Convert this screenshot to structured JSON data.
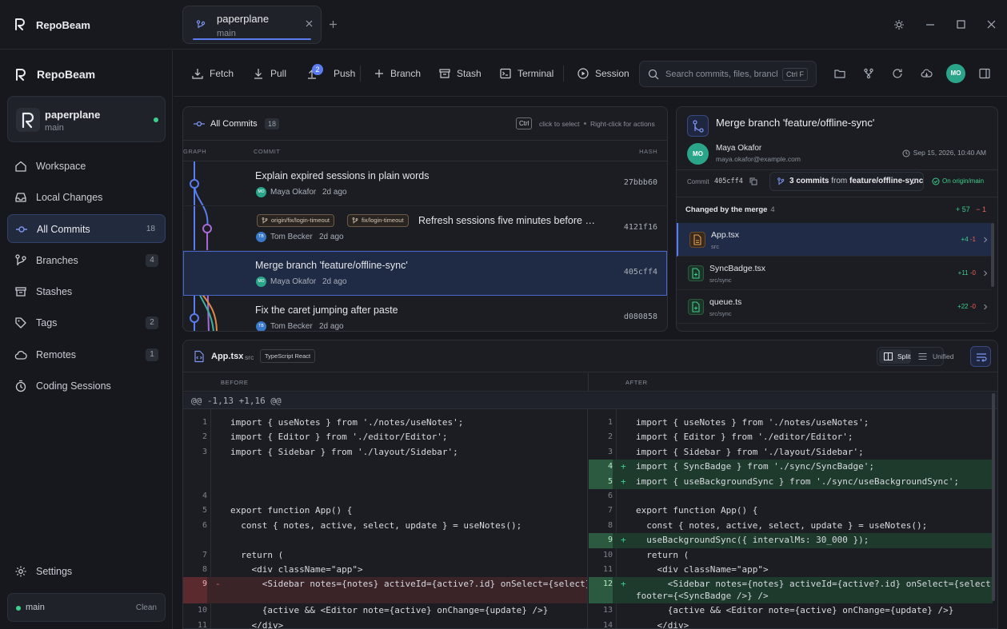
{
  "app": {
    "name": "RepoBeam"
  },
  "tab": {
    "name": "paperplane",
    "branch": "main"
  },
  "sidebar": {
    "repo": {
      "name": "paperplane",
      "branch": "main"
    },
    "items": [
      {
        "label": "Workspace",
        "icon": "home-icon"
      },
      {
        "label": "Local Changes",
        "icon": "inbox-icon"
      },
      {
        "label": "All Commits",
        "icon": "commit-icon",
        "count": "18"
      },
      {
        "label": "Branches",
        "icon": "branch-icon",
        "count": "4"
      },
      {
        "label": "Stashes",
        "icon": "archive-icon"
      },
      {
        "label": "Tags",
        "icon": "tag-icon",
        "count": "2"
      },
      {
        "label": "Remotes",
        "icon": "cloud-icon",
        "count": "1"
      },
      {
        "label": "Coding Sessions",
        "icon": "timer-icon"
      }
    ],
    "settings": "Settings",
    "status": {
      "branch": "main",
      "state": "Clean"
    }
  },
  "toolbar": {
    "fetch": "Fetch",
    "pull": "Pull",
    "push": "Push",
    "push_count": "2",
    "branch": "Branch",
    "stash": "Stash",
    "terminal": "Terminal",
    "session": "Session",
    "search_placeholder": "Search commits, files, branches",
    "search_kbd": "Ctrl F",
    "avatar": "MO"
  },
  "commits": {
    "title": "All Commits",
    "count": "18",
    "ctrl": "Ctrl",
    "hint_select": "click to select",
    "hint_actions": "Right-click for actions",
    "col_graph": "GRAPH",
    "col_commit": "COMMIT",
    "col_hash": "HASH",
    "rows": [
      {
        "message": "Explain expired sessions in plain words",
        "author": "Maya Okafor",
        "initials": "MO",
        "when": "2d ago",
        "hash": "27bbb60"
      },
      {
        "message": "Refresh sessions five minutes before the",
        "author": "Tom Becker",
        "initials": "TB",
        "when": "2d ago",
        "hash": "4121f16",
        "refs": [
          "origin/fix/login-timeout",
          "fix/login-timeout"
        ]
      },
      {
        "message": "Merge branch 'feature/offline-sync'",
        "author": "Maya Okafor",
        "initials": "MO",
        "when": "2d ago",
        "hash": "405cff4"
      },
      {
        "message": "Fix the caret jumping after paste",
        "author": "Tom Becker",
        "initials": "TB",
        "when": "2d ago",
        "hash": "d080858"
      }
    ]
  },
  "detail": {
    "title": "Merge branch 'feature/offline-sync'",
    "author": "Maya Okafor",
    "initials": "MO",
    "email": "maya.okafor@example.com",
    "date": "Sep 15, 2026, 10:40 AM",
    "commit_label": "Commit",
    "hash": "405cff4",
    "commits_count": "3 commits",
    "commits_from": "from",
    "commits_branch": "feature/offline-sync",
    "origin": "On origin/main",
    "changed_label": "Changed by the merge",
    "changed_count": "4",
    "added": "+ 57",
    "removed": "− 1",
    "files": [
      {
        "name": "App.tsx",
        "path": "src",
        "added": "+4",
        "removed": "-1"
      },
      {
        "name": "SyncBadge.tsx",
        "path": "src/sync",
        "added": "+11",
        "removed": "-0"
      },
      {
        "name": "queue.ts",
        "path": "src/sync",
        "added": "+22",
        "removed": "-0"
      }
    ]
  },
  "diff": {
    "file": "App.tsx",
    "dir": "src",
    "lang": "TypeScript React",
    "split": "Split",
    "unified": "Unified",
    "before": "BEFORE",
    "after": "AFTER",
    "hunk": "@@ -1,13 +1,16 @@",
    "left": [
      {
        "n": "1",
        "code": "import { useNotes } from './notes/useNotes';"
      },
      {
        "n": "2",
        "code": "import { Editor } from './editor/Editor';"
      },
      {
        "n": "3",
        "code": "import { Sidebar } from './layout/Sidebar';"
      },
      {
        "n": "",
        "code": ""
      },
      {
        "n": "",
        "code": ""
      },
      {
        "n": "4",
        "code": ""
      },
      {
        "n": "5",
        "code": "export function App() {"
      },
      {
        "n": "6",
        "code": "  const { notes, active, select, update } = useNotes();"
      },
      {
        "n": "",
        "code": ""
      },
      {
        "n": "7",
        "code": "  return ("
      },
      {
        "n": "8",
        "code": "    <div className=\"app\">"
      },
      {
        "n": "9",
        "code": "      <Sidebar notes={notes} activeId={active?.id} onSelect={select} />",
        "sign": "-"
      },
      {
        "n": "10",
        "code": "      {active && <Editor note={active} onChange={update} />}"
      },
      {
        "n": "11",
        "code": "    </div>"
      }
    ],
    "right": [
      {
        "n": "1",
        "code": "import { useNotes } from './notes/useNotes';"
      },
      {
        "n": "2",
        "code": "import { Editor } from './editor/Editor';"
      },
      {
        "n": "3",
        "code": "import { Sidebar } from './layout/Sidebar';"
      },
      {
        "n": "4",
        "code": "import { SyncBadge } from './sync/SyncBadge';",
        "sign": "+"
      },
      {
        "n": "5",
        "code": "import { useBackgroundSync } from './sync/useBackgroundSync';",
        "sign": "+"
      },
      {
        "n": "6",
        "code": ""
      },
      {
        "n": "7",
        "code": "export function App() {"
      },
      {
        "n": "8",
        "code": "  const { notes, active, select, update } = useNotes();"
      },
      {
        "n": "9",
        "code": "  useBackgroundSync({ intervalMs: 30_000 });",
        "sign": "+"
      },
      {
        "n": "10",
        "code": "  return ("
      },
      {
        "n": "11",
        "code": "    <div className=\"app\">"
      },
      {
        "n": "12",
        "code": "      <Sidebar notes={notes} activeId={active?.id} onSelect={select}",
        "code2": "footer={<SyncBadge />} />",
        "sign": "+"
      },
      {
        "n": "13",
        "code": "      {active && <Editor note={active} onChange={update} />}"
      },
      {
        "n": "14",
        "code": "    </div>"
      }
    ]
  }
}
